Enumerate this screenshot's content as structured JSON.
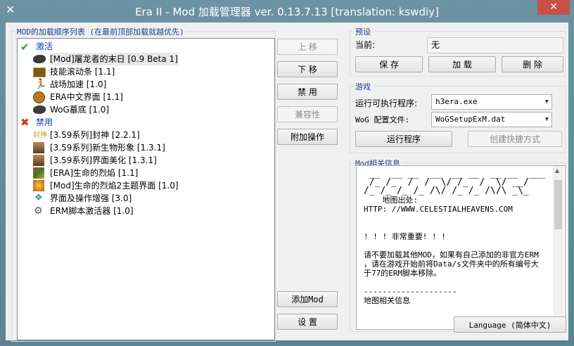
{
  "window": {
    "title": "Era II - Mod 加载管理器 ver. 0.13.7.13 [translation: kswdiy]",
    "close": "✕"
  },
  "left": {
    "group_title": "MOD的加载顺序列表 (在最前顶部加载就越优先)",
    "enabled_label": "激活",
    "enabled_items": [
      {
        "text": "[Mod]屠龙者的末日 [0.9 Beta 1]"
      },
      {
        "text": "技能滚动条 [1.1]"
      },
      {
        "text": "战场加速 [1.0]"
      },
      {
        "text": "ERA中文界面 [1.1]"
      },
      {
        "text": "WoG墓底 [1.0]"
      }
    ],
    "disabled_label": "禁用",
    "disabled_items": [
      {
        "text": "[3.59系列]封神 [2.2.1]"
      },
      {
        "text": "[3.59系列]新生物形象 [1.3.1]"
      },
      {
        "text": "[3.59系列]界面美化 [1.3.1]"
      },
      {
        "text": "[ERA]生命的烈焰 [1.1]"
      },
      {
        "text": "[Mod]生命的烈焰2主题界面 [1.0]"
      },
      {
        "text": "界面及操作增强 [3.0]"
      },
      {
        "text": "ERM脚本激活器 [1.0]"
      }
    ]
  },
  "mid_buttons": {
    "up": "上 移",
    "down": "下 移",
    "disable": "禁 用",
    "compat": "兼容性",
    "extra": "附加操作",
    "add_mod": "添加Mod",
    "settings": "设 置"
  },
  "preset": {
    "title": "预设",
    "current_label": "当前:",
    "current_value": "无",
    "save": "保 存",
    "load": "加 载",
    "delete": "删 除"
  },
  "game": {
    "title": "游戏",
    "exe_label": "运行可执行程序:",
    "exe_value": "h3era.exe",
    "cfg_label": "WoG 配置文件:",
    "cfg_value": "WoGSetupExM.dat",
    "run": "运行程序",
    "shortcut": "创建快捷方式"
  },
  "info": {
    "title": "Mod相关信息",
    "ascii_art": " __  __ __  __  __ __  __ __  ___\n /_ /_  /  /  \\/ /_  /  \\/ __/\n/_ /_ /_ /_ /\\/ /_ /_ /\\/\\ _\\_",
    "text": "    地图出处:\nHTTP: //WWW.CELESTIALHEAVENS.COM\n\n\n! ! ! 非常重要! ! !\n\n请不要加载其他MOD，如果有自己添加的非官方ERM\n，请在游戏开始前将Data/s文件夹中的所有编号大\n于77的ERM脚本移除。\n\n--------------------\n地图相关信息"
  },
  "language_button": "Language (简体中文)"
}
